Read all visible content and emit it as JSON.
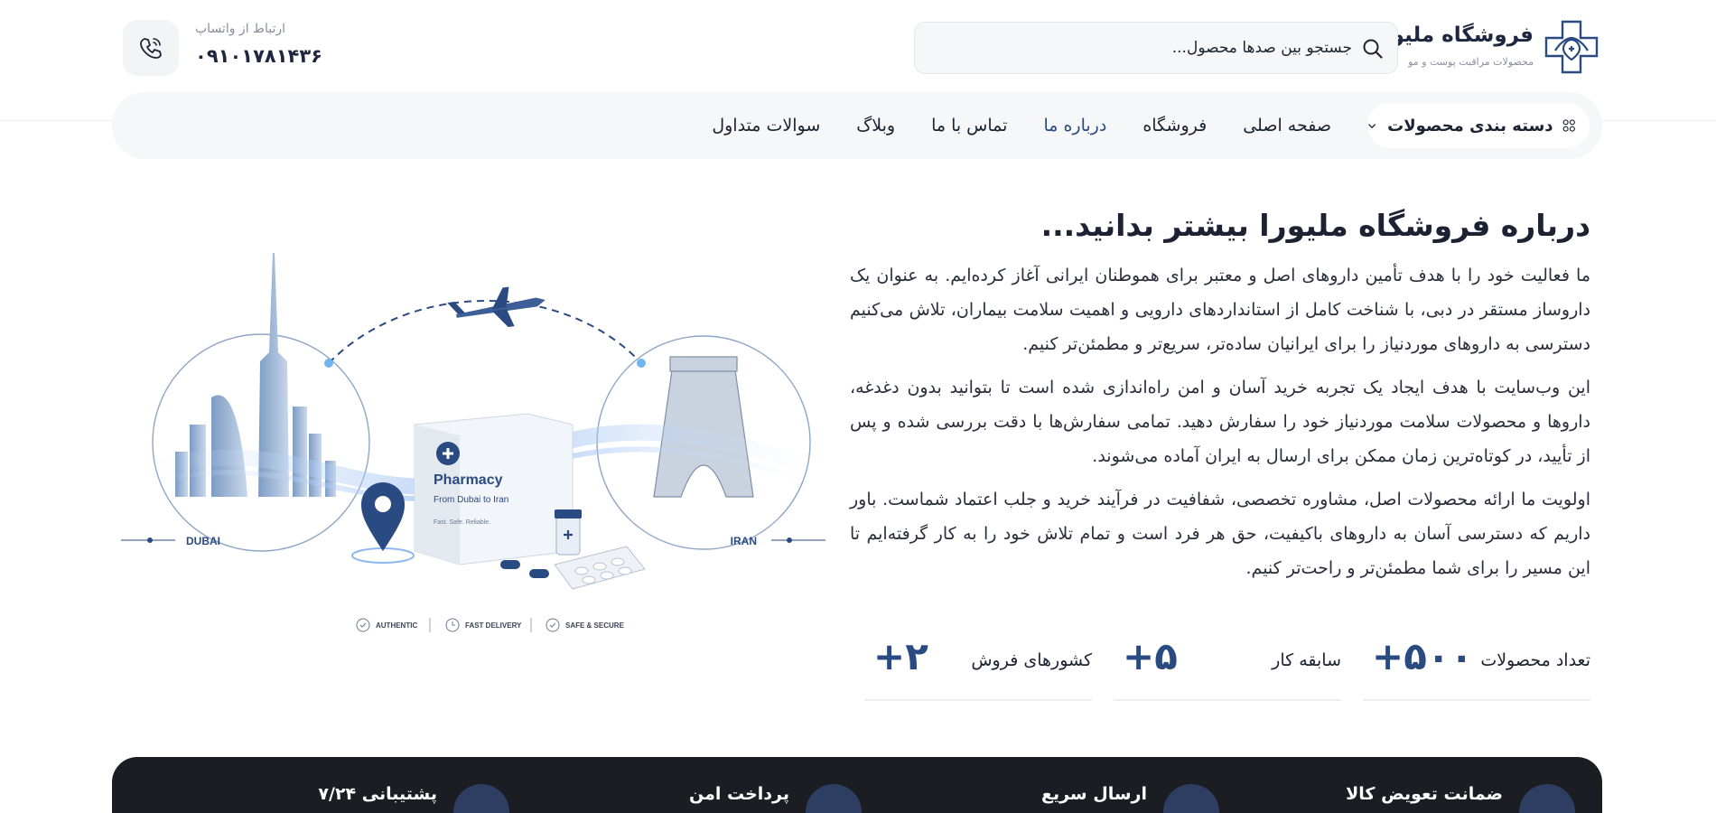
{
  "brand": {
    "name": "فروشگاه ملیورا",
    "tagline": "محصولات مراقبت پوست و مو"
  },
  "search": {
    "placeholder": "جستجو بین صدها محصول..."
  },
  "contact": {
    "label": "ارتباط از واتساپ",
    "number": "۰۹۱۰۱۷۸۱۴۳۶"
  },
  "nav": {
    "categories_label": "دسته بندی محصولات",
    "items": [
      {
        "label": "صفحه اصلی"
      },
      {
        "label": "فروشگاه"
      },
      {
        "label": "درباره ما"
      },
      {
        "label": "تماس با ما"
      },
      {
        "label": "وبلاگ"
      },
      {
        "label": "سوالات متداول"
      }
    ],
    "active_index": 2
  },
  "about": {
    "title": "درباره فروشگاه ملیورا بیشتر بدانید...",
    "paragraphs": [
      "ما فعالیت خود را با هدف تأمین داروهای اصل و معتبر برای هموطنان ایرانی آغاز کرده‌ایم. به عنوان یک داروساز مستقر در دبی، با شناخت کامل از استانداردهای دارویی و اهمیت سلامت بیماران، تلاش می‌کنیم دسترسی به داروهای موردنیاز را برای ایرانیان ساده‌تر، سریع‌تر و مطمئن‌تر کنیم.",
      "این وب‌سایت با هدف ایجاد یک تجربه خرید آسان و امن راه‌اندازی شده است تا بتوانید بدون دغدغه، داروها و محصولات سلامت موردنیاز خود را سفارش دهید. تمامی سفارش‌ها با دقت بررسی شده و پس از تأیید، در کوتاه‌ترین زمان ممکن برای ارسال به ایران آماده می‌شوند.",
      "اولویت ما ارائه محصولات اصل، مشاوره تخصصی، شفافیت در فرآیند خرید و جلب اعتماد شماست. باور داریم که دسترسی آسان به داروهای باکیفیت، حق هر فرد است و تمام تلاش خود را به کار گرفته‌ایم تا این مسیر را برای شما مطمئن‌تر و راحت‌تر کنیم."
    ]
  },
  "stats": [
    {
      "label": "تعداد محصولات",
      "value": "+۵۰۰"
    },
    {
      "label": "سابقه کار",
      "value": "+۵"
    },
    {
      "label": "کشورهای فروش",
      "value": "+۲"
    }
  ],
  "illustration": {
    "box_title": "Pharmacy",
    "box_sub": "From Dubai to Iran",
    "box_small": "Fast. Safe. Reliable.",
    "left_city": "DUBAI",
    "right_city": "IRAN",
    "badges": [
      "AUTHENTIC",
      "FAST DELIVERY",
      "SAFE & SECURE"
    ]
  },
  "features": [
    {
      "title": "ضمانت تعویض کالا"
    },
    {
      "title": "ارسال سریع"
    },
    {
      "title": "پرداخت امن"
    },
    {
      "title": "پشتیبانی ۷/۲۴"
    }
  ],
  "colors": {
    "primary": "#2a4a82",
    "dark_bar": "#1b1d22",
    "nav_bg": "#f6f7f8"
  }
}
